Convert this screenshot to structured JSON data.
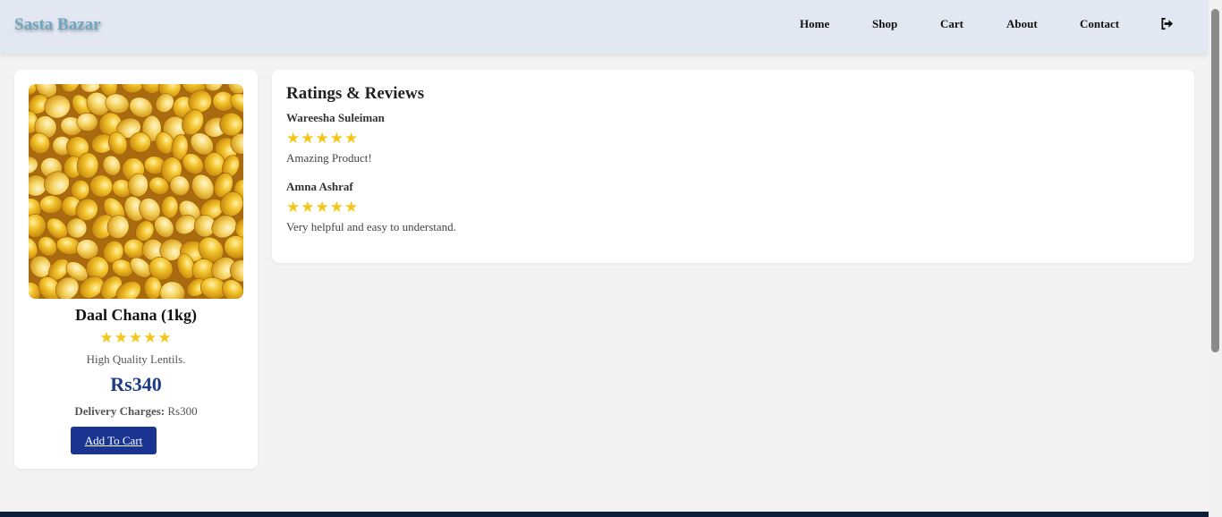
{
  "brand": "Sasta Bazar",
  "nav": {
    "links": [
      "Home",
      "Shop",
      "Cart",
      "About",
      "Contact"
    ],
    "logout_icon": "sign-out-icon"
  },
  "product": {
    "name": "Daal Chana (1kg)",
    "rating": 5,
    "rating_max": 5,
    "stars": "★★★★★",
    "description": "High Quality Lentils.",
    "price": "Rs340",
    "delivery_label": "Delivery Charges:",
    "delivery_value": "Rs300",
    "add_to_cart": "Add To Cart"
  },
  "reviews": {
    "title": "Ratings & Reviews",
    "items": [
      {
        "author": "Wareesha Suleiman",
        "rating": 5,
        "stars": "★★★★★",
        "text": "Amazing Product!"
      },
      {
        "author": "Amna Ashraf",
        "rating": 5,
        "stars": "★★★★★",
        "text": "Very helpful and easy to understand."
      }
    ]
  },
  "colors": {
    "accent": "#1a3591",
    "price": "#1e3c86",
    "star": "#f5c518",
    "navbar_bg": "#e3e7f1",
    "brand": "#6fa7c2"
  }
}
